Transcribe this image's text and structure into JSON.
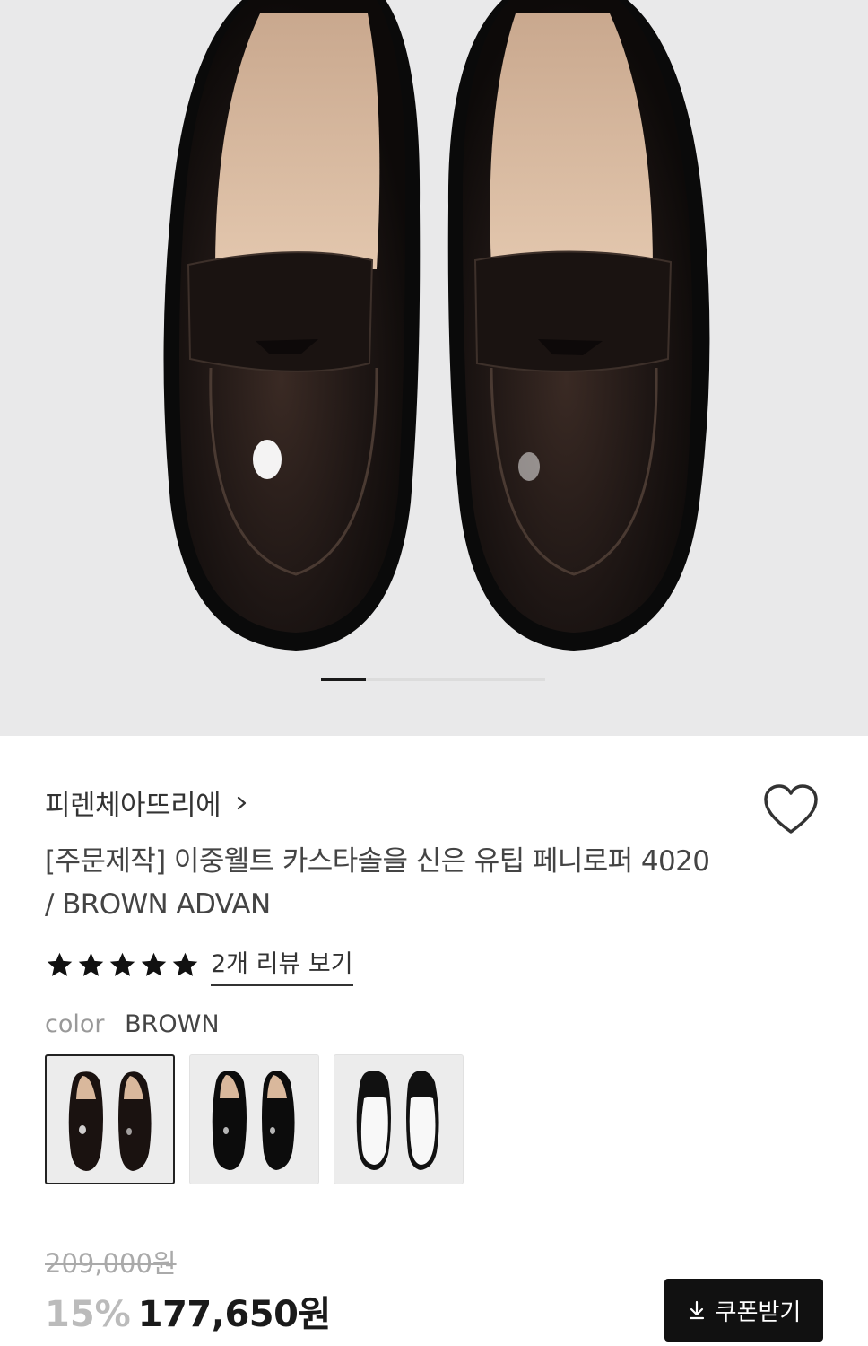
{
  "gallery": {
    "image_alt": "brown penny loafers",
    "current_index": 1,
    "total": 5
  },
  "brand": {
    "name": "피렌체아뜨리에"
  },
  "product": {
    "title": "[주문제작] 이중웰트 카스타솔을 신은 유팁 페니로퍼 4020 / BROWN ADVAN"
  },
  "rating": {
    "stars": 5,
    "review_link": "2개 리뷰 보기"
  },
  "color": {
    "label": "color",
    "selected": "BROWN",
    "options": [
      "BROWN",
      "BLACK",
      "WHITE"
    ]
  },
  "price": {
    "original": "209,000원",
    "discount": "15%",
    "final": "177,650원"
  },
  "coupon": {
    "label": "쿠폰받기"
  },
  "colors": {
    "hero_bg": "#e9e9ea",
    "button_bg": "#111111",
    "text": "#222222",
    "muted": "#999999"
  }
}
